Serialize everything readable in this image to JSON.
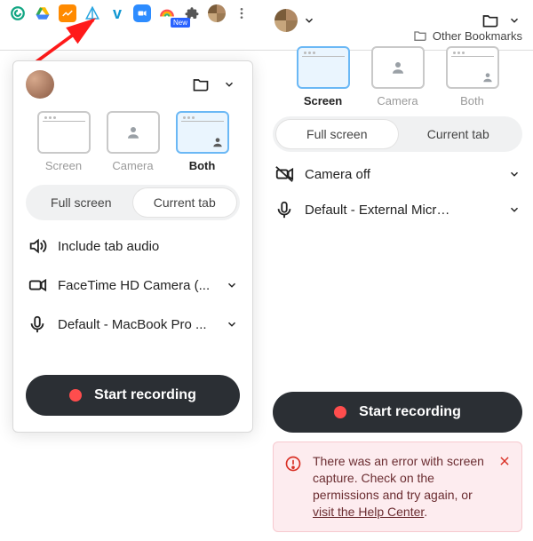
{
  "ext_icons": [
    "grammarly",
    "google-drive",
    "analytics",
    "anchor",
    "vimeo",
    "zoom",
    "rainbow",
    "puzzle",
    "avatar",
    "more"
  ],
  "ext_badge": "New",
  "bookmarks_label": "Other Bookmarks",
  "left": {
    "modes": [
      {
        "key": "screen",
        "label": "Screen",
        "selected": false
      },
      {
        "key": "camera",
        "label": "Camera",
        "selected": false
      },
      {
        "key": "both",
        "label": "Both",
        "selected": true
      }
    ],
    "seg": {
      "a": "Full screen",
      "b": "Current tab",
      "active": "b"
    },
    "audio_label": "Include tab audio",
    "camera_label": "FaceTime HD Camera (...",
    "mic_label": "Default - MacBook Pro ...",
    "record_label": "Start recording"
  },
  "right": {
    "modes": [
      {
        "key": "screen",
        "label": "Screen",
        "selected": true
      },
      {
        "key": "camera",
        "label": "Camera",
        "selected": false
      },
      {
        "key": "both",
        "label": "Both",
        "selected": false
      }
    ],
    "seg": {
      "a": "Full screen",
      "b": "Current tab",
      "active": "a"
    },
    "camera_label": "Camera off",
    "mic_label": "Default - External Micr…",
    "record_label": "Start recording",
    "error_text_1": "There was an error with screen capture. Check on the permissions and try again, or ",
    "error_link": "visit the Help Center",
    "error_text_2": "."
  }
}
